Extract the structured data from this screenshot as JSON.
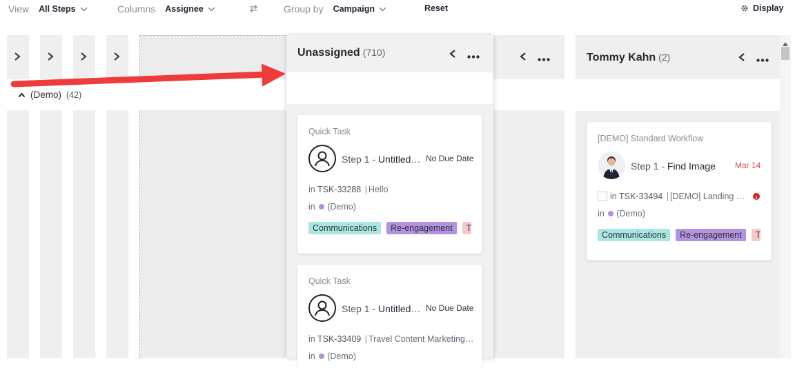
{
  "toolbar": {
    "view_label": "View",
    "view_value": "All Steps",
    "columns_label": "Columns",
    "columns_value": "Assignee",
    "group_label": "Group by",
    "group_value": "Campaign",
    "reset_label": "Reset",
    "display_label": "Display"
  },
  "group": {
    "name": "(Demo)",
    "count": "(42)"
  },
  "columns": [
    {
      "title": "Unassigned",
      "count": "(710)",
      "cards": [
        {
          "kind": "Quick Task",
          "step_prefix": "Step 1 - ",
          "step_name": "Untitled Step",
          "due": "No Due Date",
          "ref_prefix": "in",
          "ref": "TSK-33288",
          "ref_title": "Hello",
          "campaign_prefix": "in",
          "campaign": "(Demo)",
          "tags": [
            "Communications",
            "Re-engagement",
            "The"
          ]
        },
        {
          "kind": "Quick Task",
          "step_prefix": "Step 1 - ",
          "step_name": "Untitled Step",
          "due": "No Due Date",
          "ref_prefix": "in",
          "ref": "TSK-33409",
          "ref_title": "Travel Content Marketing Plan",
          "campaign_prefix": "in",
          "campaign": "(Demo)"
        }
      ]
    },
    {
      "title": "Tommy Kahn",
      "count": "(2)",
      "cards": [
        {
          "kind": "[DEMO] Standard Workflow",
          "step_prefix": "Step 1 - ",
          "step_name": "Find Image",
          "due": "Mar 14",
          "ref_prefix": "in",
          "ref": "TSK-33494",
          "ref_title": "[DEMO] Landing Page",
          "campaign_prefix": "in",
          "campaign": "(Demo)",
          "tags": [
            "Communications",
            "Re-engagement",
            "The"
          ]
        }
      ]
    }
  ],
  "colors": {
    "tag_communications": "#a8e6e3",
    "tag_reengagement": "#b392e0",
    "tag_third": "#f7c9cc",
    "due_overdue": "#e14b4b",
    "arrow": "#ee3b3b",
    "campaign_dot": "#b58fd8"
  },
  "icons": [
    "chevron-down-icon",
    "swap-icon",
    "gear-icon",
    "chevron-right-icon",
    "chevron-up-icon",
    "chevron-left-icon",
    "more-icon",
    "user-outline-icon",
    "alert-icon",
    "broken-image-icon",
    "scroll-up-icon"
  ]
}
